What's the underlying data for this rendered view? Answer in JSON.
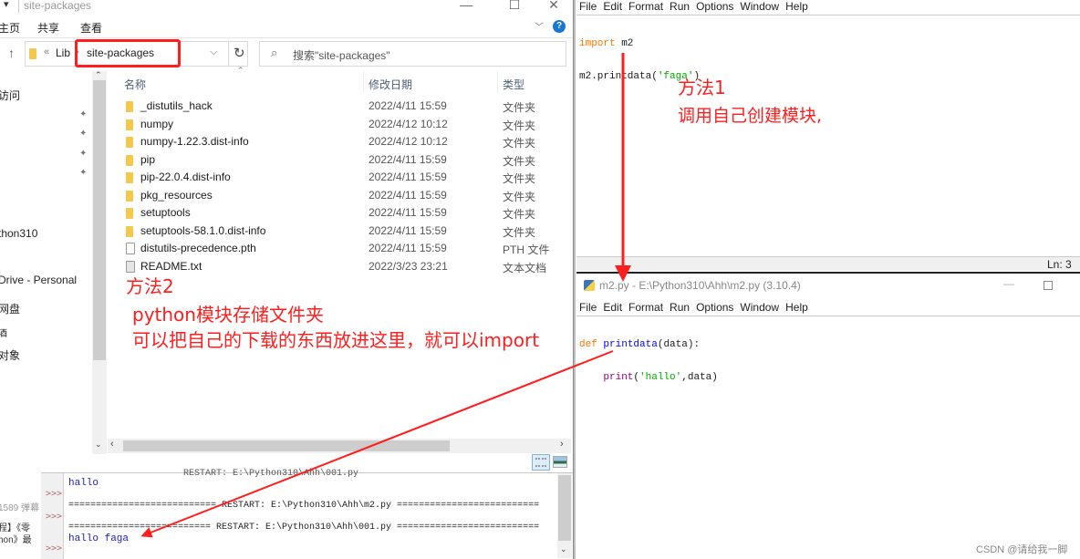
{
  "explorer": {
    "title": "site-packages",
    "quick_access_glyph": "▾",
    "window_buttons": {
      "minimize": "—",
      "maximize": "☐",
      "close": "✕"
    },
    "ribbon_tabs": [
      "主页",
      "共享",
      "查看"
    ],
    "ribbon_help": "?",
    "ribbon_expand": "﹀",
    "up_icon": "↑",
    "breadcrumb": {
      "overflow": "«",
      "items": [
        "Lib",
        "site-packages"
      ],
      "separator": "›"
    },
    "address_dropdown": "⌵",
    "refresh_icon": "↻",
    "search": {
      "icon": "⌕",
      "placeholder": "搜索\"site-packages\""
    },
    "nav_pane": {
      "items": [
        "访问",
        "thon310",
        "Drive - Personal",
        "网盘",
        "酒",
        "对象"
      ],
      "pins": [
        "✦",
        "✦",
        "✦",
        "✦"
      ]
    },
    "columns": {
      "name": "名称",
      "date": "修改日期",
      "type": "类型"
    },
    "files": [
      {
        "name": "_distutils_hack",
        "date": "2022/4/11 15:59",
        "type": "文件夹",
        "kind": "folder"
      },
      {
        "name": "numpy",
        "date": "2022/4/12 10:12",
        "type": "文件夹",
        "kind": "folder"
      },
      {
        "name": "numpy-1.22.3.dist-info",
        "date": "2022/4/12 10:12",
        "type": "文件夹",
        "kind": "folder"
      },
      {
        "name": "pip",
        "date": "2022/4/11 15:59",
        "type": "文件夹",
        "kind": "folder"
      },
      {
        "name": "pip-22.0.4.dist-info",
        "date": "2022/4/11 15:59",
        "type": "文件夹",
        "kind": "folder"
      },
      {
        "name": "pkg_resources",
        "date": "2022/4/11 15:59",
        "type": "文件夹",
        "kind": "folder"
      },
      {
        "name": "setuptools",
        "date": "2022/4/11 15:59",
        "type": "文件夹",
        "kind": "folder"
      },
      {
        "name": "setuptools-58.1.0.dist-info",
        "date": "2022/4/11 15:59",
        "type": "文件夹",
        "kind": "folder"
      },
      {
        "name": "distutils-precedence.pth",
        "date": "2022/4/11 15:59",
        "type": "PTH 文件",
        "kind": "doc"
      },
      {
        "name": "README.txt",
        "date": "2022/3/23 23:21",
        "type": "文本文档",
        "kind": "txt"
      }
    ],
    "scroll_glyphs": {
      "up": "⌃",
      "down": "⌄",
      "left": "‹",
      "right": "›"
    }
  },
  "shell": {
    "side_texts": [
      "1589 弹幕",
      "程】《零",
      "hon》最"
    ],
    "prompt": ">>>",
    "lines": [
      {
        "text": "                     RESTART: E:\\Python310\\Ahh\\001.py",
        "style": "black"
      },
      {
        "text": "hallo",
        "style": "blue"
      },
      {
        "text": "=========================== RESTART: E:\\Python310\\Ahh\\m2.py ==========================",
        "style": "black"
      },
      {
        "text": "========================== RESTART: E:\\Python310\\Ahh\\001.py ==========================",
        "style": "black"
      },
      {
        "text": "hallo faga",
        "style": "blue"
      }
    ]
  },
  "editor1": {
    "menu": [
      "File",
      "Edit",
      "Format",
      "Run",
      "Options",
      "Window",
      "Help"
    ],
    "code": {
      "line1_kw": "import",
      "line1_rest": " m2",
      "line2_pre": "m2.printdata(",
      "line2_str": "'faga'",
      "line2_post": ")"
    },
    "status": "Ln: 3"
  },
  "editor2": {
    "title": "m2.py - E:\\Python310\\Ahh\\m2.py (3.10.4)",
    "window_buttons": {
      "minimize": "—"
    },
    "menu": [
      "File",
      "Edit",
      "Format",
      "Run",
      "Options",
      "Window",
      "Help"
    ],
    "code": {
      "line1_kw": "def",
      "line1_fn": "printdata",
      "line1_rest": "(data):",
      "line2_indent": "    ",
      "line2_bi": "print",
      "line2_open": "(",
      "line2_str": "'hallo'",
      "line2_post": ",data)"
    }
  },
  "annotations": {
    "method1_title": "方法1",
    "method1_desc": "调用自己创建模块,",
    "method2_title": "方法2",
    "method2_line1": "python模块存储文件夹",
    "method2_line2": "可以把自己的下载的东西放进这里，就可以import",
    "color": "#ff1e1e"
  },
  "watermark": "CSDN @请给我一脚"
}
